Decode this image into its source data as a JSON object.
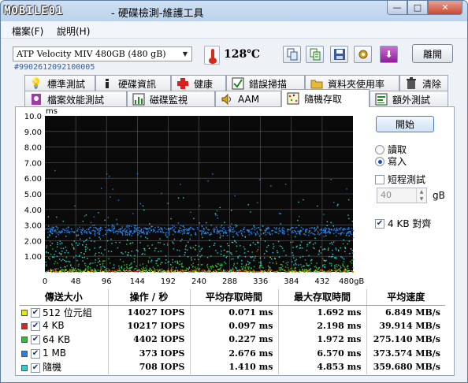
{
  "app": {
    "logo_text": "MOBILE01",
    "title_suffix": "- 硬碟檢測-維護工具"
  },
  "window_controls": {
    "minimize": "—",
    "maximize": "□",
    "close": "✕"
  },
  "menu": [
    "檔案(F)",
    "說明(H)"
  ],
  "toolbar": {
    "disk": "ATP Velocity MIV 480GB  (480 gB)",
    "serial": "#9902612092100005",
    "temperature": "128℃",
    "exit_label": "離開",
    "buttons": [
      "copy-icon",
      "copy-text-icon",
      "save-icon",
      "tools-icon",
      "download-icon"
    ]
  },
  "tabs_row1": [
    {
      "label": "標準測試",
      "icon": "lightbulb-icon"
    },
    {
      "label": "硬碟資訊",
      "icon": "info-icon"
    },
    {
      "label": "健康",
      "icon": "health-cross-icon"
    },
    {
      "label": "錯誤掃描",
      "icon": "scan-icon"
    },
    {
      "label": "資料夾使用率",
      "icon": "folder-icon"
    },
    {
      "label": "清除",
      "icon": "trash-icon"
    }
  ],
  "tabs_row2": [
    {
      "label": "檔案效能測試",
      "icon": "file-benchmark-icon"
    },
    {
      "label": "磁碟監視",
      "icon": "disk-monitor-icon"
    },
    {
      "label": "AAM",
      "icon": "speaker-icon"
    },
    {
      "label": "隨機存取",
      "icon": "random-access-icon",
      "active": true
    },
    {
      "label": "額外測試",
      "icon": "extra-tests-icon"
    }
  ],
  "controls": {
    "start": "開始",
    "read": "讀取",
    "write": "寫入",
    "mode_selected": "write",
    "short_test": "短程測試",
    "short_test_checked": false,
    "short_size": "40",
    "short_unit": "gB",
    "align": "4 KB 對齊",
    "align_checked": true
  },
  "chart_data": {
    "type": "scatter",
    "ylabel": "ms",
    "ylim": [
      0,
      10
    ],
    "yticks": [
      "10.0",
      "9.00",
      "8.00",
      "7.00",
      "6.00",
      "5.00",
      "4.00",
      "3.00",
      "2.00",
      "1.00"
    ],
    "xlim": [
      0,
      480
    ],
    "xticks": [
      "0",
      "48",
      "96",
      "144",
      "192",
      "240",
      "288",
      "336",
      "384",
      "432",
      "480gB"
    ],
    "grid": true,
    "series": [
      {
        "name": "512 位元組",
        "color": "#e8e800",
        "typical_ms": 0.07,
        "max_ms": 1.692
      },
      {
        "name": "4 KB",
        "color": "#e02020",
        "typical_ms": 0.1,
        "max_ms": 2.198
      },
      {
        "name": "64 KB",
        "color": "#30c030",
        "typical_ms": 0.23,
        "max_ms": 1.972
      },
      {
        "name": "1 MB",
        "color": "#2a7ee8",
        "typical_ms": 2.68,
        "max_ms": 6.57
      },
      {
        "name": "隨機",
        "color": "#27d4d4",
        "typical_ms": 1.41,
        "max_ms": 4.853
      }
    ]
  },
  "results": {
    "headers": [
      "傳送大小",
      "操作 / 秒",
      "平均存取時間",
      "最大存取時間",
      "平均速度"
    ],
    "rows": [
      {
        "name": "512 位元組",
        "color": "#e8e800",
        "ops": "14027 IOPS",
        "avg": "0.071 ms",
        "max": "1.692 ms",
        "speed": "6.849 MB/s"
      },
      {
        "name": "4 KB",
        "color": "#e02020",
        "ops": "10217 IOPS",
        "avg": "0.097 ms",
        "max": "2.198 ms",
        "speed": "39.914 MB/s"
      },
      {
        "name": "64 KB",
        "color": "#30c030",
        "ops": "4402 IOPS",
        "avg": "0.227 ms",
        "max": "1.972 ms",
        "speed": "275.140 MB/s"
      },
      {
        "name": "1 MB",
        "color": "#2a7ee8",
        "ops": "373 IOPS",
        "avg": "2.676 ms",
        "max": "6.570 ms",
        "speed": "373.574 MB/s"
      },
      {
        "name": "隨機",
        "color": "#27d4d4",
        "ops": "708 IOPS",
        "avg": "1.410 ms",
        "max": "4.853 ms",
        "speed": "359.680 MB/s"
      }
    ]
  }
}
